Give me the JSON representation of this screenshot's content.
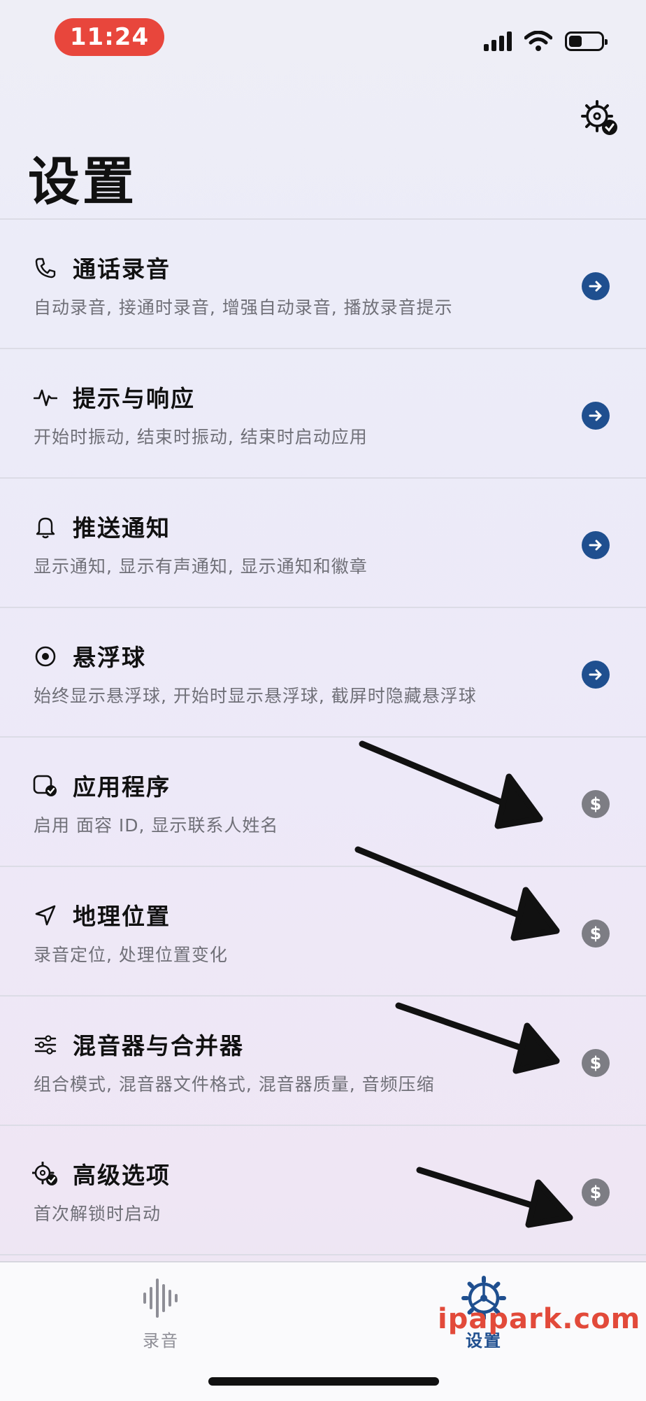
{
  "status_bar": {
    "time": "11:24",
    "time_pill_color": "#e8463c"
  },
  "header": {
    "title": "设置",
    "corner_icon": "gear-check-icon"
  },
  "settings": [
    {
      "icon": "phone-icon",
      "title": "通话录音",
      "subtitle": "自动录音, 接通时录音, 增强自动录音, 播放录音提示",
      "action": "arrow"
    },
    {
      "icon": "waveform-pulse-icon",
      "title": "提示与响应",
      "subtitle": "开始时振动, 结束时振动, 结束时启动应用",
      "action": "arrow"
    },
    {
      "icon": "bell-icon",
      "title": "推送通知",
      "subtitle": "显示通知, 显示有声通知, 显示通知和徽章",
      "action": "arrow"
    },
    {
      "icon": "floating-ball-icon",
      "title": "悬浮球",
      "subtitle": "始终显示悬浮球, 开始时显示悬浮球, 截屏时隐藏悬浮球",
      "action": "arrow"
    },
    {
      "icon": "app-check-icon",
      "title": "应用程序",
      "subtitle": "启用 面容 ID, 显示联系人姓名",
      "action": "dollar"
    },
    {
      "icon": "location-arrow-icon",
      "title": "地理位置",
      "subtitle": "录音定位, 处理位置变化",
      "action": "dollar"
    },
    {
      "icon": "sliders-icon",
      "title": "混音器与合并器",
      "subtitle": "组合模式, 混音器文件格式, 混音器质量, 音频压缩",
      "action": "dollar"
    },
    {
      "icon": "gear-check-icon",
      "title": "高级选项",
      "subtitle": "首次解锁时启动",
      "action": "dollar"
    }
  ],
  "action_glyphs": {
    "dollar": "$"
  },
  "tabs": [
    {
      "icon": "waveform-icon",
      "label": "录音",
      "active": false
    },
    {
      "icon": "gear-icon",
      "label": "设置",
      "active": true
    }
  ],
  "watermark": "ipapark.com",
  "colors": {
    "accent": "#1f4f8f",
    "paid_badge": "#7d7d84",
    "watermark": "#e24a3a"
  }
}
